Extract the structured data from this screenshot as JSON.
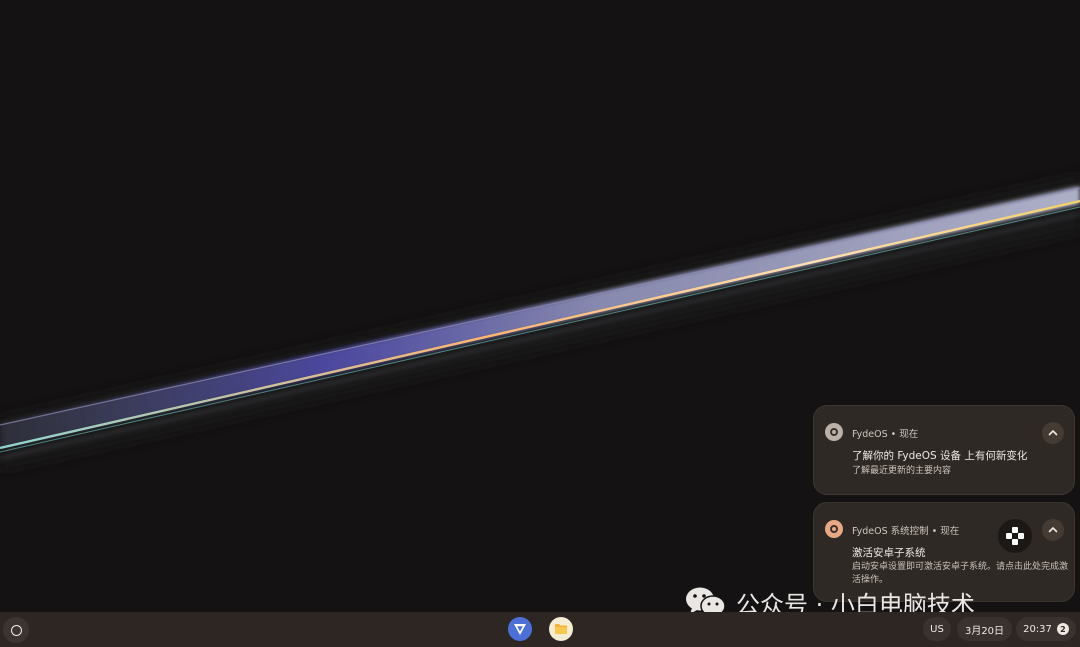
{
  "notifications": [
    {
      "app": "FydeOS",
      "time": "现在",
      "title": "了解你的 FydeOS 设备 上有何新变化",
      "body": "了解最近更新的主要内容",
      "icon": "fydeos-icon"
    },
    {
      "app": "FydeOS 系统控制",
      "time": "现在",
      "title": "激活安卓子系统",
      "body": "启动安卓设置即可激活安卓子系统。请点击此处完成激活操作。",
      "icon": "fydeos-icon",
      "image_icon": "gamepad-icon"
    }
  ],
  "watermark": {
    "text": "公众号 · 小白电脑技术",
    "icon": "wechat-icon"
  },
  "shelf": {
    "launcher_icon": "launcher-circle-icon",
    "apps": [
      {
        "name": "FydeOS app",
        "icon": "fydeos-app-icon"
      },
      {
        "name": "Files",
        "icon": "files-icon"
      }
    ],
    "ime": "US",
    "date": "3月20日",
    "time": "20:37",
    "notification_count": "2"
  },
  "colors": {
    "desktop_bg": "#141212",
    "shelf_bg": "#2d2623",
    "notification_bg": "#2f2925",
    "accent_blue": "#4d6fd8"
  }
}
